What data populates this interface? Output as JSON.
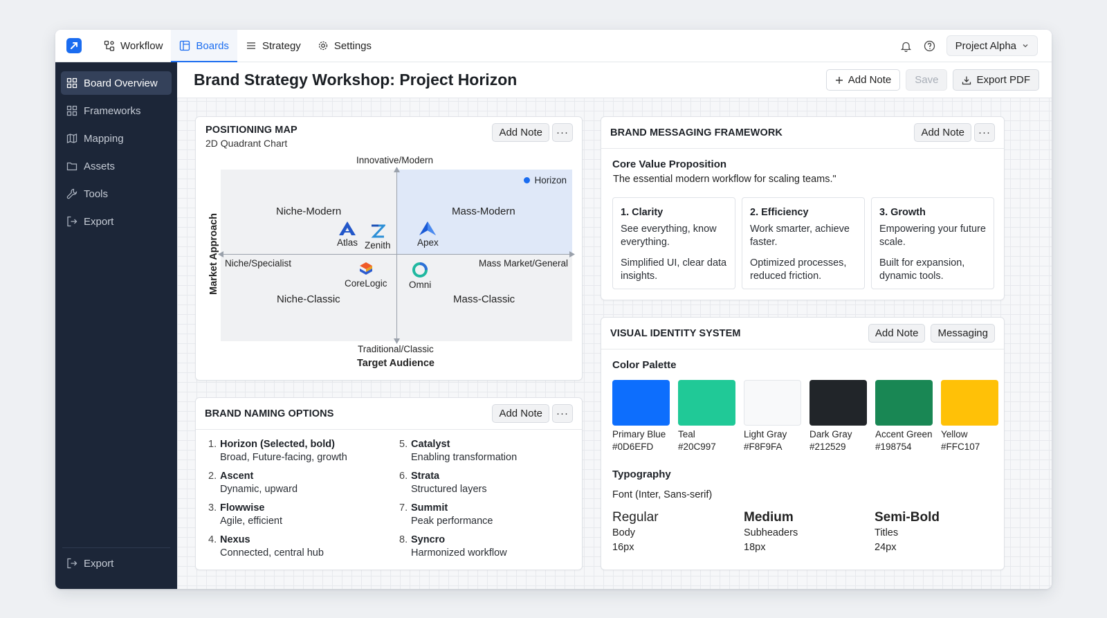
{
  "nav": {
    "tabs": [
      {
        "label": "Workflow",
        "icon": "workflow-icon"
      },
      {
        "label": "Boards",
        "icon": "boards-icon"
      },
      {
        "label": "Strategy",
        "icon": "list-icon"
      },
      {
        "label": "Settings",
        "icon": "gear-icon"
      }
    ],
    "active_tab": "Boards",
    "project": "Project Alpha"
  },
  "sidebar": {
    "items": [
      {
        "label": "Board Overview",
        "icon": "grid-icon"
      },
      {
        "label": "Frameworks",
        "icon": "grid-icon"
      },
      {
        "label": "Mapping",
        "icon": "map-icon"
      },
      {
        "label": "Assets",
        "icon": "folder-icon"
      },
      {
        "label": "Tools",
        "icon": "wrench-icon"
      },
      {
        "label": "Export",
        "icon": "export-icon"
      }
    ],
    "bottom_item": {
      "label": "Export",
      "icon": "export-icon"
    }
  },
  "header": {
    "title": "Brand Strategy Workshop: Project Horizon",
    "add_note": "Add Note",
    "save": "Save",
    "export_pdf": "Export PDF"
  },
  "positioning": {
    "title": "POSITIONING MAP",
    "subtitle": "2D Quadrant Chart",
    "add_note": "Add Note",
    "more": "···",
    "top_label": "Innovative/Modern",
    "bottom_label": "Traditional/Classic",
    "left_label": "Niche/Specialist",
    "right_label": "Mass Market/General",
    "x_axis_title": "Target Audience",
    "y_axis_title": "Market Approach",
    "quadrants": [
      "Niche-Modern",
      "Mass-Modern",
      "Niche-Classic",
      "Mass-Classic"
    ],
    "legend": "Horizon",
    "brands": [
      {
        "name": "Atlas",
        "icon": "atlas-logo"
      },
      {
        "name": "Zenith",
        "icon": "zenith-logo"
      },
      {
        "name": "Apex",
        "icon": "apex-logo"
      },
      {
        "name": "CoreLogic",
        "icon": "corelogic-logo"
      },
      {
        "name": "Omni",
        "icon": "omni-logo"
      }
    ]
  },
  "messaging": {
    "title": "BRAND MESSAGING FRAMEWORK",
    "add_note": "Add Note",
    "more": "···",
    "core_title": "Core Value Proposition",
    "core_text": "The essential modern workflow for scaling teams.\"",
    "pillars": [
      {
        "title": "1. Clarity",
        "line1": "See everything, know everything.",
        "line2": "Simplified UI, clear data insights."
      },
      {
        "title": "2. Efficiency",
        "line1": "Work smarter, achieve faster.",
        "line2": "Optimized processes, reduced friction."
      },
      {
        "title": "3. Growth",
        "line1": "Empowering your future scale.",
        "line2": "Built for expansion, dynamic tools."
      }
    ]
  },
  "naming": {
    "title": "BRAND NAMING OPTIONS",
    "add_note": "Add Note",
    "more": "···",
    "options": [
      {
        "num": "1.",
        "name": "Horizon (Selected, bold)",
        "desc": "Broad, Future-facing, growth"
      },
      {
        "num": "5.",
        "name": "Catalyst",
        "desc": "Enabling transformation"
      },
      {
        "num": "2.",
        "name": "Ascent",
        "desc": "Dynamic, upward"
      },
      {
        "num": "6.",
        "name": "Strata",
        "desc": "Structured layers"
      },
      {
        "num": "3.",
        "name": "Flowwise",
        "desc": "Agile, efficient"
      },
      {
        "num": "7.",
        "name": "Summit",
        "desc": "Peak performance"
      },
      {
        "num": "4.",
        "name": "Nexus",
        "desc": "Connected, central hub"
      },
      {
        "num": "8.",
        "name": "Syncro",
        "desc": "Harmonized workflow"
      }
    ]
  },
  "identity": {
    "title": "VISUAL IDENTITY SYSTEM",
    "add_note": "Add Note",
    "messaging_btn": "Messaging",
    "palette_title": "Color Palette",
    "colors": [
      {
        "name": "Primary Blue",
        "hex": "#0D6EFD"
      },
      {
        "name": "Teal",
        "hex": "#20C997"
      },
      {
        "name": "Light Gray",
        "hex": "#F8F9FA"
      },
      {
        "name": "Dark Gray",
        "hex": "#212529"
      },
      {
        "name": "Accent Green",
        "hex": "#198754"
      },
      {
        "name": "Yellow",
        "hex": "#FFC107"
      }
    ],
    "typography_title": "Typography",
    "font": "Font (Inter, Sans-serif)",
    "weights": [
      {
        "weight": "Regular",
        "use": "Body",
        "size": "16px"
      },
      {
        "weight": "Medium",
        "use": "Subheaders",
        "size": "18px"
      },
      {
        "weight": "Semi-Bold",
        "use": "Titles",
        "size": "24px"
      }
    ]
  }
}
